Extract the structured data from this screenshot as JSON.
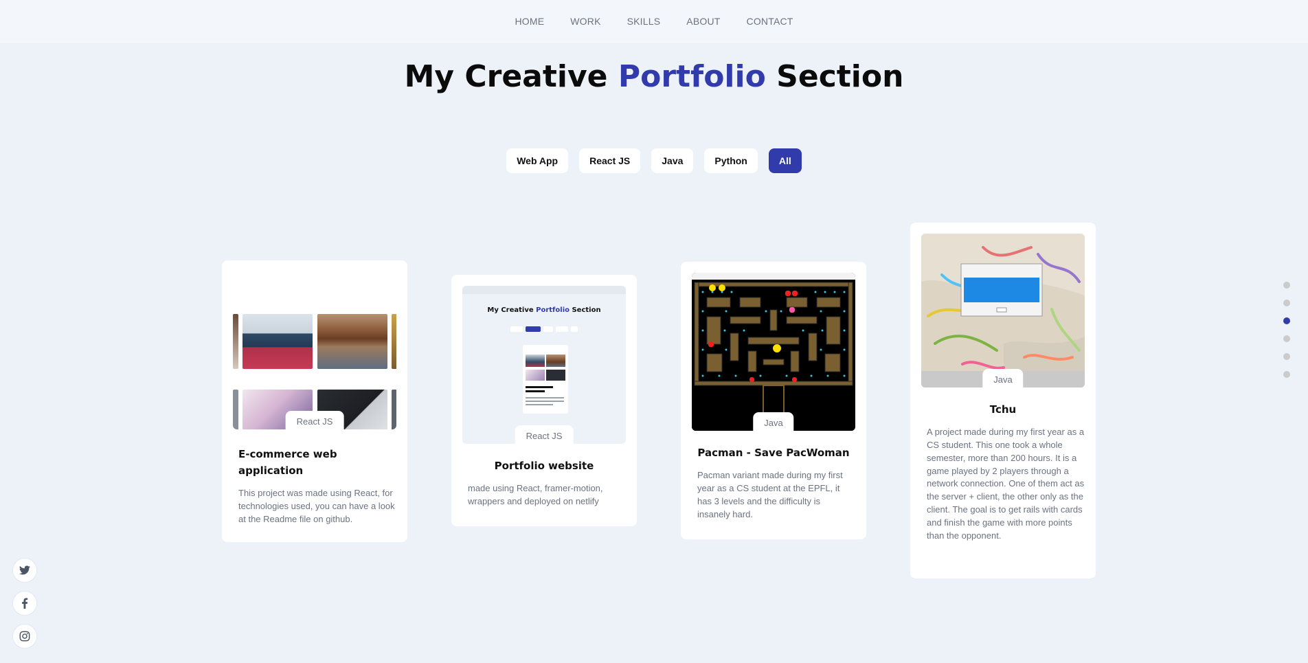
{
  "nav": {
    "items": [
      "HOME",
      "WORK",
      "SKILLS",
      "ABOUT",
      "CONTACT"
    ]
  },
  "heading": {
    "part1": "My Creative",
    "accent": "Portfolio",
    "part2": "Section"
  },
  "filters": {
    "items": [
      "Web App",
      "React JS",
      "Java",
      "Python",
      "All"
    ],
    "active": "All"
  },
  "projects": [
    {
      "title": "E-commerce web application",
      "tag": "React JS",
      "description": "This project was made using React, for technologies used, you can have a look at the Readme file on github."
    },
    {
      "title": "Portfolio website",
      "tag": "React JS",
      "description": "made using React, framer-motion, wrappers and deployed on netlify",
      "thumb_heading": {
        "part1": "My Creative",
        "accent": "Portfolio",
        "part2": "Section"
      }
    },
    {
      "title": "Pacman - Save PacWoman",
      "tag": "Java",
      "description": "Pacman variant made during my first year as a CS student at the EPFL, it has 3 levels and the difficulty is insanely hard."
    },
    {
      "title": "Tchu",
      "tag": "Java",
      "description": "A project made during my first year as a CS student. This one took a whole semester, more than 200 hours. It is a game played by 2 players through a network connection. One of them act as the server + client, the other only as the client. The goal is to get rails with cards and finish the game with more points than the opponent."
    }
  ],
  "section_dots": {
    "count": 6,
    "active_index": 2
  },
  "social": [
    "twitter-icon",
    "facebook-icon",
    "instagram-icon"
  ],
  "colors": {
    "accent": "#313bac",
    "background": "#edf2f8",
    "muted_text": "#6b7280"
  }
}
